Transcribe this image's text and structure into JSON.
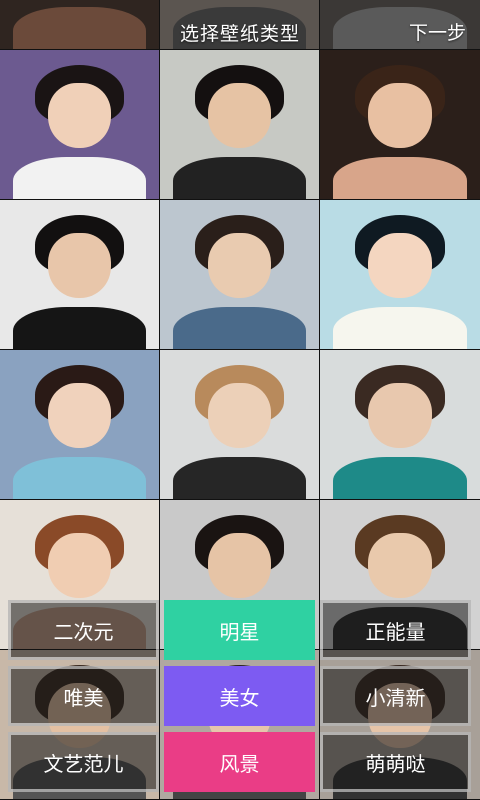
{
  "header": {
    "title": "选择壁纸类型",
    "next_label": "下一步"
  },
  "wallpapers": [
    {
      "bg": "#2f2520",
      "hair": "#3a2a20",
      "face": "#e6c2a6",
      "body": "#6b4a3a"
    },
    {
      "bg": "#5b5550",
      "hair": "#4a3a30",
      "face": "#e8c8ae",
      "body": "#3a3a3a"
    },
    {
      "bg": "#3b3836",
      "hair": "#2c2520",
      "face": "#e6c7ad",
      "body": "#5a5a5a"
    },
    {
      "bg": "#6c5a90",
      "hair": "#1a1414",
      "face": "#f0d0b8",
      "body": "#f2f2f2"
    },
    {
      "bg": "#c7c9c4",
      "hair": "#141010",
      "face": "#e6c3a4",
      "body": "#222222"
    },
    {
      "bg": "#2b1f1a",
      "hair": "#3a2418",
      "face": "#e8c0a2",
      "body": "#d8a58a"
    },
    {
      "bg": "#e8e8e8",
      "hair": "#121010",
      "face": "#e8c6aa",
      "body": "#151515"
    },
    {
      "bg": "#bcc6cf",
      "hair": "#2a1f1a",
      "face": "#e9cbb0",
      "body": "#4a6a8a"
    },
    {
      "bg": "#b9dce5",
      "hair": "#0f1a22",
      "face": "#f4d6c0",
      "body": "#f6f6ee"
    },
    {
      "bg": "#8aa2c0",
      "hair": "#2a1a16",
      "face": "#f0d2bc",
      "body": "#7fc0d8"
    },
    {
      "bg": "#dadcdc",
      "hair": "#b88a5c",
      "face": "#ecd0b8",
      "body": "#262626"
    },
    {
      "bg": "#d8dcdc",
      "hair": "#3a2a22",
      "face": "#e8c8ae",
      "body": "#1e8a88"
    },
    {
      "bg": "#e6e0d8",
      "hair": "#8a4a28",
      "face": "#f0cdb2",
      "body": "#c8a08a"
    },
    {
      "bg": "#c9c9c9",
      "hair": "#1a1412",
      "face": "#e6c4a6",
      "body": "#1a1a1a"
    },
    {
      "bg": "#d2d2d2",
      "hair": "#5a3a22",
      "face": "#e9c9ac",
      "body": "#2a2a2a"
    },
    {
      "bg": "#c8b8a8",
      "hair": "#3a2a20",
      "face": "#e4c0a2",
      "body": "#555555"
    },
    {
      "bg": "#b0a8a0",
      "hair": "#2a2220",
      "face": "#e6c6ac",
      "body": "#444444"
    },
    {
      "bg": "#a8a098",
      "hair": "#3a2a22",
      "face": "#e6c4a8",
      "body": "#333333"
    }
  ],
  "categories": [
    {
      "label": "二次元",
      "style": "outline",
      "color": ""
    },
    {
      "label": "明星",
      "style": "filled",
      "color": "#2fd1a2"
    },
    {
      "label": "正能量",
      "style": "outline",
      "color": ""
    },
    {
      "label": "唯美",
      "style": "outline",
      "color": ""
    },
    {
      "label": "美女",
      "style": "filled",
      "color": "#7d5bf2"
    },
    {
      "label": "小清新",
      "style": "outline",
      "color": ""
    },
    {
      "label": "文艺范儿",
      "style": "outline",
      "color": ""
    },
    {
      "label": "风景",
      "style": "filled",
      "color": "#ea3d86"
    },
    {
      "label": "萌萌哒",
      "style": "outline",
      "color": ""
    }
  ]
}
